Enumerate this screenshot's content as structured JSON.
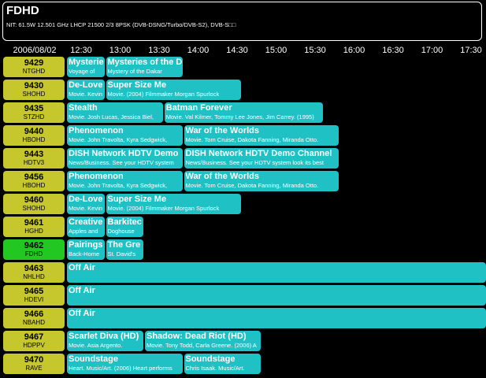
{
  "header": {
    "title": "FDHD",
    "info": "NIT: 61.5W 12.501 GHz LHCP 21500 2/3 8PSK (DVB-DSNG/Turbo/DVB-S2), DVB-S□□"
  },
  "timebar": {
    "date": "2006/08/02",
    "times": [
      "12:30",
      "13:00",
      "13:30",
      "14:00",
      "14:30",
      "15:00",
      "15:30",
      "16:00",
      "16:30",
      "17:00",
      "17:30"
    ]
  },
  "rows": [
    {
      "num": "9429",
      "call": "NTGHD",
      "programs": [
        {
          "title": "Mysterie",
          "desc": "Voyage of",
          "start": 0,
          "end": 0.5
        },
        {
          "title": "Mysteries of the D",
          "desc": "Mystery of the Dakar",
          "start": 0.5,
          "end": 1.5
        }
      ]
    },
    {
      "num": "9430",
      "call": "SHOHD",
      "programs": [
        {
          "title": "De-Love",
          "desc": "Movie. Kevin",
          "start": 0,
          "end": 0.5
        },
        {
          "title": "Super Size Me",
          "desc": "Movie.  (2004) Filmmaker Morgan Spurlock",
          "start": 0.5,
          "end": 2.25
        }
      ]
    },
    {
      "num": "9435",
      "call": "STZHD",
      "programs": [
        {
          "title": "Stealth",
          "desc": "Movie. Josh Lucas, Jessica Biel,",
          "start": 0,
          "end": 1.25
        },
        {
          "title": "Batman Forever",
          "desc": "Movie. Val Kilmer, Tommy Lee Jones, Jim Carrey.  (1995)",
          "start": 1.25,
          "end": 3.3
        }
      ]
    },
    {
      "num": "9440",
      "call": "HBOHD",
      "programs": [
        {
          "title": "Phenomenon",
          "desc": "Movie. John Travolta, Kyra Sedgwick,",
          "start": 0,
          "end": 1.5
        },
        {
          "title": "War of the Worlds",
          "desc": "Movie. Tom Cruise, Dakota Fanning, Miranda Otto.",
          "start": 1.5,
          "end": 3.5
        }
      ]
    },
    {
      "num": "9443",
      "call": "HDTV3",
      "programs": [
        {
          "title": "DISH Network HDTV Demo",
          "desc": "News/Business. See your HDTV system",
          "start": 0,
          "end": 1.5
        },
        {
          "title": "DISH Network HDTV Demo Channel",
          "desc": "News/Business. See your HDTV system look its best",
          "start": 1.5,
          "end": 3.5
        }
      ]
    },
    {
      "num": "9456",
      "call": "HBOHD",
      "programs": [
        {
          "title": "Phenomenon",
          "desc": "Movie. John Travolta, Kyra Sedgwick,",
          "start": 0,
          "end": 1.5
        },
        {
          "title": "War of the Worlds",
          "desc": "Movie. Tom Cruise, Dakota Fanning, Miranda Otto.",
          "start": 1.5,
          "end": 3.5
        }
      ]
    },
    {
      "num": "9460",
      "call": "SHOHD",
      "programs": [
        {
          "title": "De-Love",
          "desc": "Movie. Kevin",
          "start": 0,
          "end": 0.5
        },
        {
          "title": "Super Size Me",
          "desc": "Movie.  (2004) Filmmaker Morgan Spurlock",
          "start": 0.5,
          "end": 2.25
        }
      ]
    },
    {
      "num": "9461",
      "call": "HGHD",
      "programs": [
        {
          "title": "Creative",
          "desc": "Apples and",
          "start": 0,
          "end": 0.5
        },
        {
          "title": "Barkitec",
          "desc": "Doghouse",
          "start": 0.5,
          "end": 1
        }
      ]
    },
    {
      "num": "9462",
      "call": "FDHD",
      "selected": true,
      "programs": [
        {
          "title": "Pairings",
          "desc": "Back-Home",
          "start": 0,
          "end": 0.5
        },
        {
          "title": "The Gre",
          "desc": "St. David's",
          "start": 0.5,
          "end": 1
        }
      ]
    },
    {
      "num": "9463",
      "call": "NHLHD",
      "programs": [
        {
          "title": "Off Air",
          "desc": "",
          "start": 0,
          "end": 6
        }
      ]
    },
    {
      "num": "9465",
      "call": "HDEVI",
      "programs": [
        {
          "title": "Off Air",
          "desc": "",
          "start": 0,
          "end": 6
        }
      ]
    },
    {
      "num": "9466",
      "call": "NBAHD",
      "programs": [
        {
          "title": "Off Air",
          "desc": "",
          "start": 0,
          "end": 6
        }
      ]
    },
    {
      "num": "9467",
      "call": "HDPPV",
      "programs": [
        {
          "title": "Scarlet Diva (HD)",
          "desc": "Movie. Asia Argento.",
          "start": 0,
          "end": 1
        },
        {
          "title": "Shadow: Dead Riot (HD)",
          "desc": "Movie. Tony Todd, Carla Greene.  (2006) A",
          "start": 1,
          "end": 2.5
        }
      ]
    },
    {
      "num": "9470",
      "call": "RAVE",
      "programs": [
        {
          "title": "Soundstage",
          "desc": "Heart. Music/Art.  (2006) Heart performs",
          "start": 0,
          "end": 1.5
        },
        {
          "title": "Soundstage",
          "desc": "Chris Isaak. Music/Art.",
          "start": 1.5,
          "end": 2.5
        }
      ]
    }
  ]
}
